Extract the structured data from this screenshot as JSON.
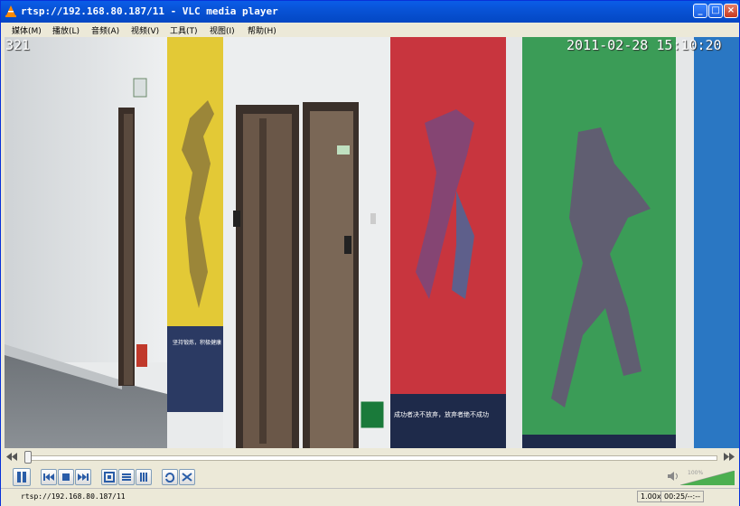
{
  "window": {
    "title": "rtsp://192.168.80.187/11 - VLC media player"
  },
  "menu": [
    "媒体(M)",
    "播放(L)",
    "音频(A)",
    "视频(V)",
    "工具(T)",
    "视图(I)",
    "帮助(H)"
  ],
  "video": {
    "osd_left": "321",
    "osd_datetime": "2011-02-28 15:10:20",
    "sign_left": "坚持锻炼，积极健康",
    "sign_right": "成功者决不放弃，放弃者绝不成功"
  },
  "controls": {
    "seek_position": 0.0,
    "volume_percent": "100%",
    "volume_level": 1.0
  },
  "status": {
    "url": "rtsp://192.168.80.187/11",
    "speed": "1.00x",
    "time": "00:25/--:--"
  },
  "colors": {
    "titlebar": "#0853d6",
    "chrome": "#ece9d8",
    "poster_yellow": "#e3c936",
    "poster_red": "#c8353e",
    "poster_green": "#3b9c57",
    "poster_blue": "#2a77c3"
  }
}
